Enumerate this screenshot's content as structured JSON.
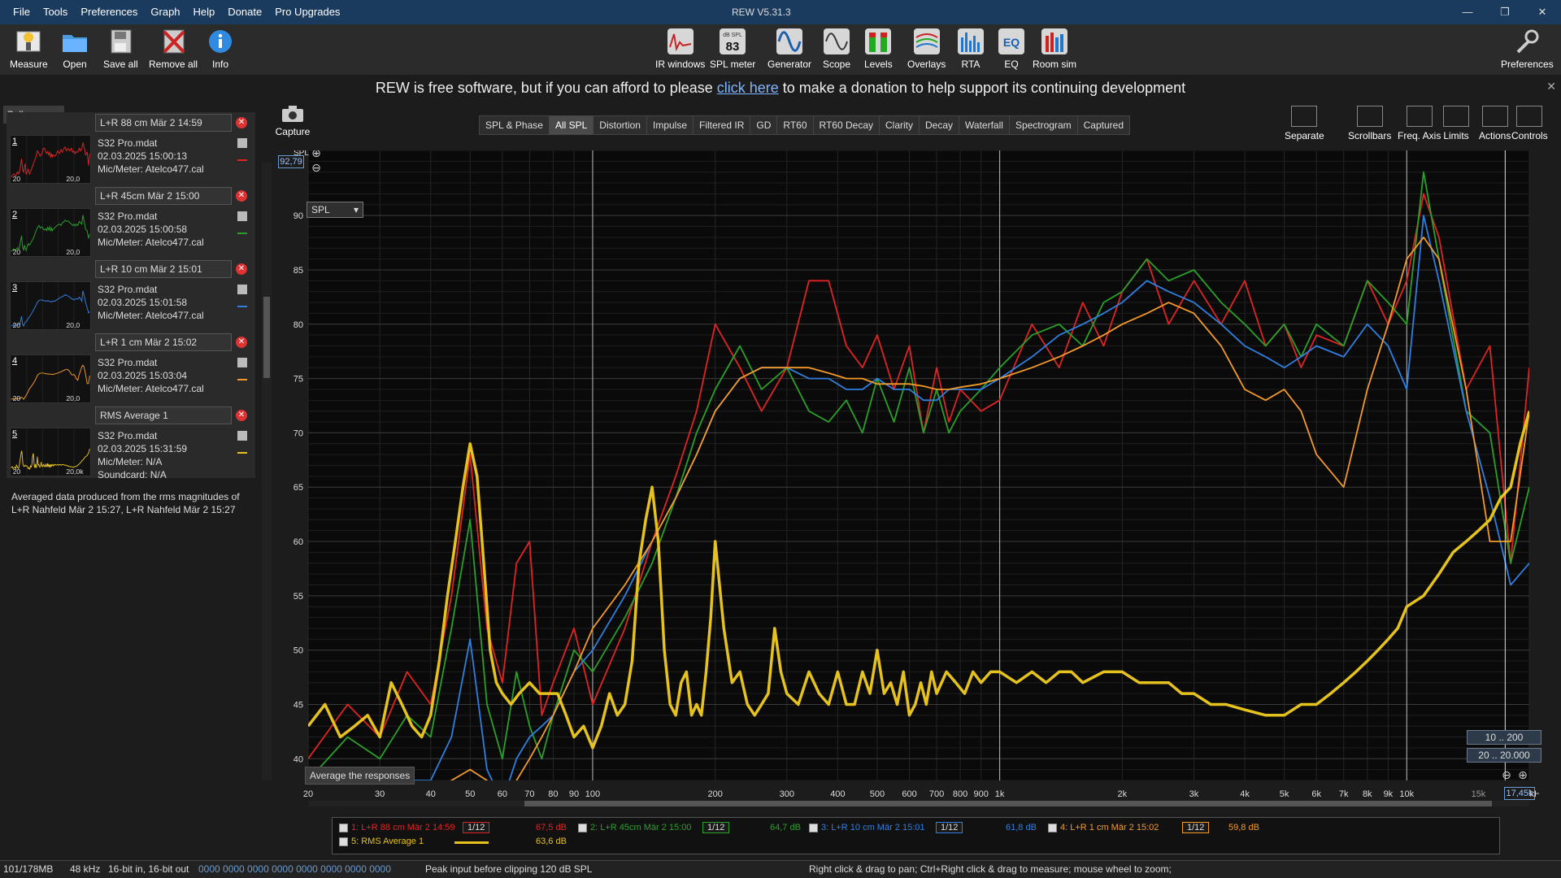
{
  "menu": [
    "File",
    "Tools",
    "Preferences",
    "Graph",
    "Help",
    "Donate",
    "Pro Upgrades"
  ],
  "window_title": "REW V5.31.3",
  "window_controls": [
    "—",
    "❐",
    "✕"
  ],
  "toolbar": {
    "left": [
      {
        "label": "Measure",
        "icon": "microphone-icon",
        "color": "#f2c230"
      },
      {
        "label": "Open",
        "icon": "folder-icon",
        "color": "#4a9ae0"
      },
      {
        "label": "Save all",
        "icon": "save-icon",
        "color": "#999999"
      },
      {
        "label": "Remove all",
        "icon": "remove-all-icon",
        "color": "#cc2222"
      },
      {
        "label": "Info",
        "icon": "info-icon",
        "color": "#2f8ae0"
      }
    ],
    "center": [
      {
        "label": "IR windows",
        "icon": "ir-windows-icon"
      },
      {
        "label": "SPL meter",
        "icon": "spl-meter-icon",
        "sub": "dB SPL",
        "value": "83"
      },
      {
        "label": "Generator",
        "icon": "generator-icon"
      },
      {
        "label": "Scope",
        "icon": "scope-icon"
      },
      {
        "label": "Levels",
        "icon": "levels-icon"
      },
      {
        "label": "Overlays",
        "icon": "overlays-icon"
      },
      {
        "label": "RTA",
        "icon": "rta-icon"
      },
      {
        "label": "EQ",
        "icon": "eq-icon"
      },
      {
        "label": "Room sim",
        "icon": "room-sim-icon"
      }
    ],
    "right": {
      "label": "Preferences",
      "icon": "wrench-icon"
    }
  },
  "banner": {
    "before": "REW is free software, but if you can afford to please ",
    "link": "click here",
    "after": " to make a donation to help support its continuing development",
    "close": "✕"
  },
  "left_panel": {
    "collapse_label": "Collapse",
    "measurements": [
      {
        "num": "1",
        "name": "L+R 88 cm Mär 2 14:59",
        "file": "S32 Pro.mdat",
        "date": "02.03.2025 15:00:13",
        "mic": "Mic/Meter: Atelco477.cal",
        "color": "#e02424",
        "xl": "20",
        "xr": "20,0"
      },
      {
        "num": "2",
        "name": "L+R 45cm Mär 2 15:00",
        "file": "S32 Pro.mdat",
        "date": "02.03.2025 15:00:58",
        "mic": "Mic/Meter: Atelco477.cal",
        "color": "#2aa02a",
        "xl": "20",
        "xr": "20,0"
      },
      {
        "num": "3",
        "name": "L+R 10 cm Mär 2 15:01",
        "file": "S32 Pro.mdat",
        "date": "02.03.2025 15:01:58",
        "mic": "Mic/Meter: Atelco477.cal",
        "color": "#2f7fe0",
        "xl": "20",
        "xr": "20,0"
      },
      {
        "num": "4",
        "name": "L+R 1 cm Mär 2 15:02",
        "file": "S32 Pro.mdat",
        "date": "02.03.2025 15:03:04",
        "mic": "Mic/Meter: Atelco477.cal",
        "color": "#f39a2a",
        "xl": "20",
        "xr": "20,0"
      },
      {
        "num": "5",
        "name": "RMS Average 1",
        "file": "S32 Pro.mdat",
        "date": "02.03.2025 15:31:59",
        "mic": "Mic/Meter: N/A",
        "card": "Soundcard: N/A",
        "color": "#e6c21e",
        "xl": "20",
        "xr": "20,0k"
      }
    ],
    "avg_description": "Averaged data produced from the rms magnitudes of L+R Nahfeld Mär 2 15:27, L+R Nahfeld Mär 2 15:27"
  },
  "graph_header": {
    "capture_label": "Capture",
    "tabs": [
      "SPL & Phase",
      "All SPL",
      "Distortion",
      "Impulse",
      "Filtered IR",
      "GD",
      "RT60",
      "RT60 Decay",
      "Clarity",
      "Decay",
      "Waterfall",
      "Spectrogram",
      "Captured"
    ],
    "selected_tab": "All SPL",
    "right_tools": [
      "Separate",
      "Scrollbars",
      "Freq. Axis",
      "Limits",
      "Actions",
      "Controls"
    ]
  },
  "plot_controls": {
    "spl_label": "SPL",
    "spl_readout": "92,79",
    "dropdown": "SPL",
    "average_button": "Average the responses",
    "range_a": "10 .. 200",
    "range_b": "20 .. 20.000",
    "cursor_freq": "17,45k",
    "axis_unit": "kHz"
  },
  "chart_data": {
    "type": "line",
    "x_scale": "log",
    "xlim": [
      20,
      20000
    ],
    "ylim": [
      38,
      96
    ],
    "xlabel": "",
    "ylabel": "SPL",
    "grid": true,
    "x_ticks": [
      20,
      30,
      40,
      50,
      60,
      70,
      80,
      90,
      100,
      200,
      300,
      400,
      500,
      600,
      700,
      800,
      900,
      1000,
      2000,
      3000,
      4000,
      5000,
      6000,
      7000,
      8000,
      9000,
      10000,
      15000
    ],
    "x_tick_labels": [
      "20",
      "30",
      "40",
      "50",
      "60",
      "70",
      "80",
      "90",
      "100",
      "200",
      "300",
      "400",
      "500",
      "600",
      "700",
      "800",
      "900",
      "1k",
      "2k",
      "3k",
      "4k",
      "5k",
      "6k",
      "7k",
      "8k",
      "9k",
      "10k",
      "15k"
    ],
    "y_ticks": [
      40,
      45,
      50,
      55,
      60,
      65,
      70,
      75,
      80,
      85,
      90
    ],
    "series": [
      {
        "name": "1: L+R 88 cm Mär 2 14:59",
        "color": "#e02424",
        "x": [
          20,
          25,
          30,
          35,
          40,
          45,
          50,
          55,
          60,
          65,
          70,
          75,
          80,
          90,
          100,
          120,
          140,
          160,
          180,
          200,
          230,
          260,
          300,
          340,
          380,
          420,
          460,
          500,
          550,
          600,
          650,
          700,
          750,
          800,
          900,
          1000,
          1200,
          1400,
          1600,
          1800,
          2000,
          2300,
          2600,
          3000,
          3500,
          4000,
          4500,
          5000,
          5500,
          6000,
          7000,
          8000,
          9000,
          10000,
          11000,
          12000,
          14000,
          16000,
          18000,
          20000
        ],
        "y": [
          40,
          45,
          42,
          48,
          45,
          55,
          68,
          52,
          47,
          58,
          60,
          44,
          47,
          52,
          45,
          52,
          60,
          66,
          72,
          80,
          76,
          72,
          76,
          84,
          84,
          78,
          76,
          79,
          74,
          78,
          70,
          76,
          71,
          74,
          72,
          73,
          80,
          76,
          82,
          78,
          83,
          86,
          80,
          84,
          80,
          84,
          78,
          80,
          76,
          79,
          78,
          84,
          80,
          84,
          92,
          88,
          74,
          78,
          58,
          76
        ]
      },
      {
        "name": "2: L+R 45cm Mär 2 15:00",
        "color": "#2aa02a",
        "x": [
          20,
          25,
          30,
          35,
          40,
          45,
          50,
          55,
          60,
          65,
          70,
          75,
          80,
          90,
          100,
          120,
          140,
          160,
          180,
          200,
          230,
          260,
          300,
          340,
          380,
          420,
          460,
          500,
          550,
          600,
          650,
          700,
          750,
          800,
          900,
          1000,
          1200,
          1400,
          1600,
          1800,
          2000,
          2300,
          2600,
          3000,
          3500,
          4000,
          4500,
          5000,
          5500,
          6000,
          7000,
          8000,
          9000,
          10000,
          11000,
          12000,
          14000,
          16000,
          18000,
          20000
        ],
        "y": [
          38,
          42,
          40,
          44,
          42,
          52,
          62,
          45,
          40,
          48,
          43,
          40,
          44,
          50,
          48,
          53,
          58,
          64,
          70,
          74,
          78,
          74,
          76,
          72,
          71,
          73,
          70,
          75,
          71,
          76,
          70,
          74,
          70,
          72,
          74,
          76,
          79,
          80,
          78,
          82,
          83,
          86,
          84,
          85,
          82,
          80,
          78,
          80,
          77,
          80,
          78,
          84,
          82,
          80,
          94,
          86,
          72,
          70,
          58,
          65
        ]
      },
      {
        "name": "3: L+R 10 cm Mär 2 15:01",
        "color": "#2f7fe0",
        "x": [
          20,
          25,
          30,
          35,
          40,
          45,
          50,
          55,
          60,
          65,
          70,
          75,
          80,
          90,
          100,
          120,
          140,
          160,
          180,
          200,
          230,
          260,
          300,
          340,
          380,
          420,
          460,
          500,
          550,
          600,
          650,
          700,
          750,
          800,
          900,
          1000,
          1200,
          1400,
          1600,
          1800,
          2000,
          2300,
          2600,
          3000,
          3500,
          4000,
          4500,
          5000,
          5500,
          6000,
          7000,
          8000,
          9000,
          10000,
          11000,
          12000,
          14000,
          16000,
          18000,
          20000
        ],
        "y": [
          36,
          38,
          36,
          38,
          38,
          42,
          51,
          39,
          36,
          40,
          42,
          43,
          44,
          48,
          50,
          55,
          60,
          64,
          68,
          72,
          75,
          76,
          76,
          75,
          75,
          74,
          74,
          75,
          74,
          74,
          73,
          73,
          74,
          74,
          74,
          75,
          77,
          79,
          80,
          81,
          82,
          84,
          83,
          82,
          80,
          78,
          77,
          76,
          77,
          78,
          77,
          80,
          78,
          74,
          90,
          84,
          72,
          64,
          56,
          58
        ]
      },
      {
        "name": "4: L+R 1 cm Mär 2 15:02",
        "color": "#f39a2a",
        "x": [
          20,
          25,
          30,
          35,
          40,
          45,
          50,
          55,
          60,
          65,
          70,
          75,
          80,
          90,
          100,
          120,
          140,
          160,
          180,
          200,
          230,
          260,
          300,
          340,
          380,
          420,
          460,
          500,
          550,
          600,
          650,
          700,
          750,
          800,
          900,
          1000,
          1200,
          1400,
          1600,
          1800,
          2000,
          2300,
          2600,
          3000,
          3500,
          4000,
          4500,
          5000,
          5500,
          6000,
          7000,
          8000,
          9000,
          10000,
          11000,
          12000,
          14000,
          16000,
          18000,
          20000
        ],
        "y": [
          36,
          37,
          36,
          37,
          37,
          38,
          39,
          38,
          36,
          38,
          40,
          42,
          44,
          48,
          52,
          56,
          60,
          64,
          68,
          72,
          75,
          76,
          76,
          76,
          75.5,
          75,
          75,
          74.5,
          74.5,
          74.5,
          74.3,
          74,
          74,
          74.2,
          74.5,
          75,
          76,
          77,
          78,
          79,
          80,
          81,
          82,
          81,
          78,
          74,
          73,
          74,
          72,
          68,
          65,
          74,
          80,
          86,
          88,
          86,
          74,
          60,
          60,
          72
        ]
      },
      {
        "name": "5: RMS Average 1",
        "color": "#e6c21e",
        "x": [
          20,
          22,
          24,
          26,
          28,
          30,
          32,
          34,
          36,
          38,
          40,
          42,
          44,
          46,
          48,
          50,
          52,
          54,
          56,
          58,
          60,
          63,
          66,
          70,
          74,
          78,
          82,
          86,
          90,
          95,
          100,
          105,
          110,
          115,
          120,
          125,
          130,
          135,
          140,
          145,
          150,
          155,
          160,
          165,
          170,
          175,
          180,
          185,
          190,
          195,
          200,
          210,
          220,
          230,
          240,
          250,
          260,
          270,
          280,
          290,
          300,
          320,
          340,
          360,
          380,
          400,
          420,
          440,
          460,
          480,
          500,
          520,
          540,
          560,
          580,
          600,
          620,
          640,
          660,
          680,
          700,
          740,
          780,
          820,
          860,
          900,
          950,
          1000,
          1100,
          1200,
          1300,
          1400,
          1500,
          1600,
          1800,
          2000,
          2200,
          2400,
          2600,
          2800,
          3000,
          3300,
          3600,
          4000,
          4500,
          5000,
          5500,
          6000,
          6500,
          7000,
          7500,
          8000,
          8500,
          9000,
          9500,
          10000,
          11000,
          12000,
          13000,
          14000,
          15000,
          16000,
          17000,
          18000,
          19000,
          20000
        ],
        "y": [
          43,
          45,
          42,
          43,
          44,
          42,
          47,
          45,
          43,
          42,
          44,
          49,
          55,
          60,
          65,
          69,
          66,
          58,
          50,
          47,
          46,
          45,
          46,
          47,
          46,
          46,
          46,
          44,
          42,
          43,
          41,
          43,
          46,
          44,
          45,
          49,
          58,
          62,
          65,
          60,
          50,
          45,
          44,
          47,
          48,
          44,
          45,
          44,
          48,
          53,
          60,
          52,
          47,
          48,
          45,
          44,
          45,
          46,
          52,
          48,
          46,
          45,
          48,
          46,
          45,
          48,
          45,
          45,
          48,
          46,
          50,
          46,
          47,
          45,
          48,
          44,
          45,
          47,
          45,
          48,
          46,
          48,
          47,
          46,
          48,
          47,
          48,
          48,
          47,
          48,
          47,
          48,
          48,
          47,
          48,
          48,
          47,
          47,
          47,
          46,
          46,
          45,
          45,
          44.5,
          44,
          44,
          45,
          45,
          46,
          47,
          48,
          49,
          50,
          51,
          52,
          54,
          55,
          57,
          59,
          60,
          61,
          62,
          64,
          65,
          69,
          72
        ]
      }
    ]
  },
  "legend": [
    {
      "label": "1: L+R 88 cm Mär 2 14:59",
      "smoothing": "1/12",
      "value": "67,5 dB",
      "color": "#e02424"
    },
    {
      "label": "2: L+R 45cm Mär 2 15:00",
      "smoothing": "1/12",
      "value": "64,7 dB",
      "color": "#2aa02a"
    },
    {
      "label": "3: L+R 10 cm Mär 2 15:01",
      "smoothing": "1/12",
      "value": "61,8 dB",
      "color": "#2f7fe0"
    },
    {
      "label": "4: L+R 1 cm Mär 2 15:02",
      "smoothing": "1/12",
      "value": "59,8 dB",
      "color": "#f39a2a"
    },
    {
      "label": "5: RMS Average 1",
      "value": "63,6 dB",
      "color": "#e6c21e"
    }
  ],
  "status": {
    "memory": "101/178MB",
    "rate": "48 kHz",
    "bits": "16-bit in, 16-bit out",
    "levels": "0000 0000  0000 0000  0000 0000  0000 0000",
    "peak": "Peak input before clipping 120 dB SPL",
    "hint": "Right click & drag to pan; Ctrl+Right click & drag to measure; mouse wheel to zoom;"
  }
}
